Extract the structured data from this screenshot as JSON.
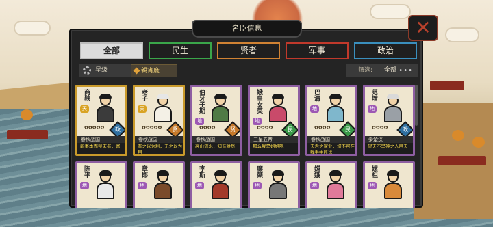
{
  "dialog": {
    "title": "名臣信息",
    "close_icon": "close-icon"
  },
  "tabs": [
    {
      "label": "全部",
      "active": true,
      "color": "#dcdcdc"
    },
    {
      "label": "民生",
      "active": false,
      "color": "#3aa64a"
    },
    {
      "label": "贤者",
      "active": false,
      "color": "#d08233"
    },
    {
      "label": "军事",
      "active": false,
      "color": "#c0392b"
    },
    {
      "label": "政治",
      "active": false,
      "color": "#3a8fbd"
    }
  ],
  "filters": {
    "star_sort": "星级",
    "fav_sort": "親宵度",
    "screen_label": "筛选:",
    "screen_value": "全部",
    "more": "•••"
  },
  "cards": [
    {
      "name": "商鞅",
      "badge": "天",
      "category": "政",
      "era": "春秋战国",
      "quote": "能事本而禁末者，富",
      "frame": "gold"
    },
    {
      "name": "老子",
      "badge": "天",
      "category": "贤",
      "era": "春秋战国",
      "quote": "有之以为利，无之以为用",
      "frame": "gold"
    },
    {
      "name": "伯牙子期",
      "badge": "地",
      "category": "贤",
      "era": "春秋战国",
      "quote": "高山流水，知音难觅",
      "frame": "purple"
    },
    {
      "name": "娥皇女英",
      "badge": "地",
      "category": "民",
      "era": "三皇五帝",
      "quote": "那么我是姐姐呢",
      "frame": "purple"
    },
    {
      "name": "巴清",
      "badge": "地",
      "category": "民",
      "era": "春秋战国",
      "quote": "夫君之家业，切不可在我手中断送",
      "frame": "purple"
    },
    {
      "name": "范增",
      "badge": "地",
      "category": "政",
      "era": "秦楚汉",
      "quote": "望夫不早神之人用夫",
      "frame": "purple"
    },
    {
      "name": "陈平",
      "badge": "地",
      "frame": "purple"
    },
    {
      "name": "章邯",
      "badge": "地",
      "frame": "purple"
    },
    {
      "name": "李斯",
      "badge": "地",
      "frame": "purple"
    },
    {
      "name": "廉颇",
      "badge": "地",
      "frame": "purple"
    },
    {
      "name": "嫦娥",
      "badge": "地",
      "frame": "purple"
    },
    {
      "name": "嫘祖",
      "badge": "地",
      "frame": "purple"
    }
  ]
}
